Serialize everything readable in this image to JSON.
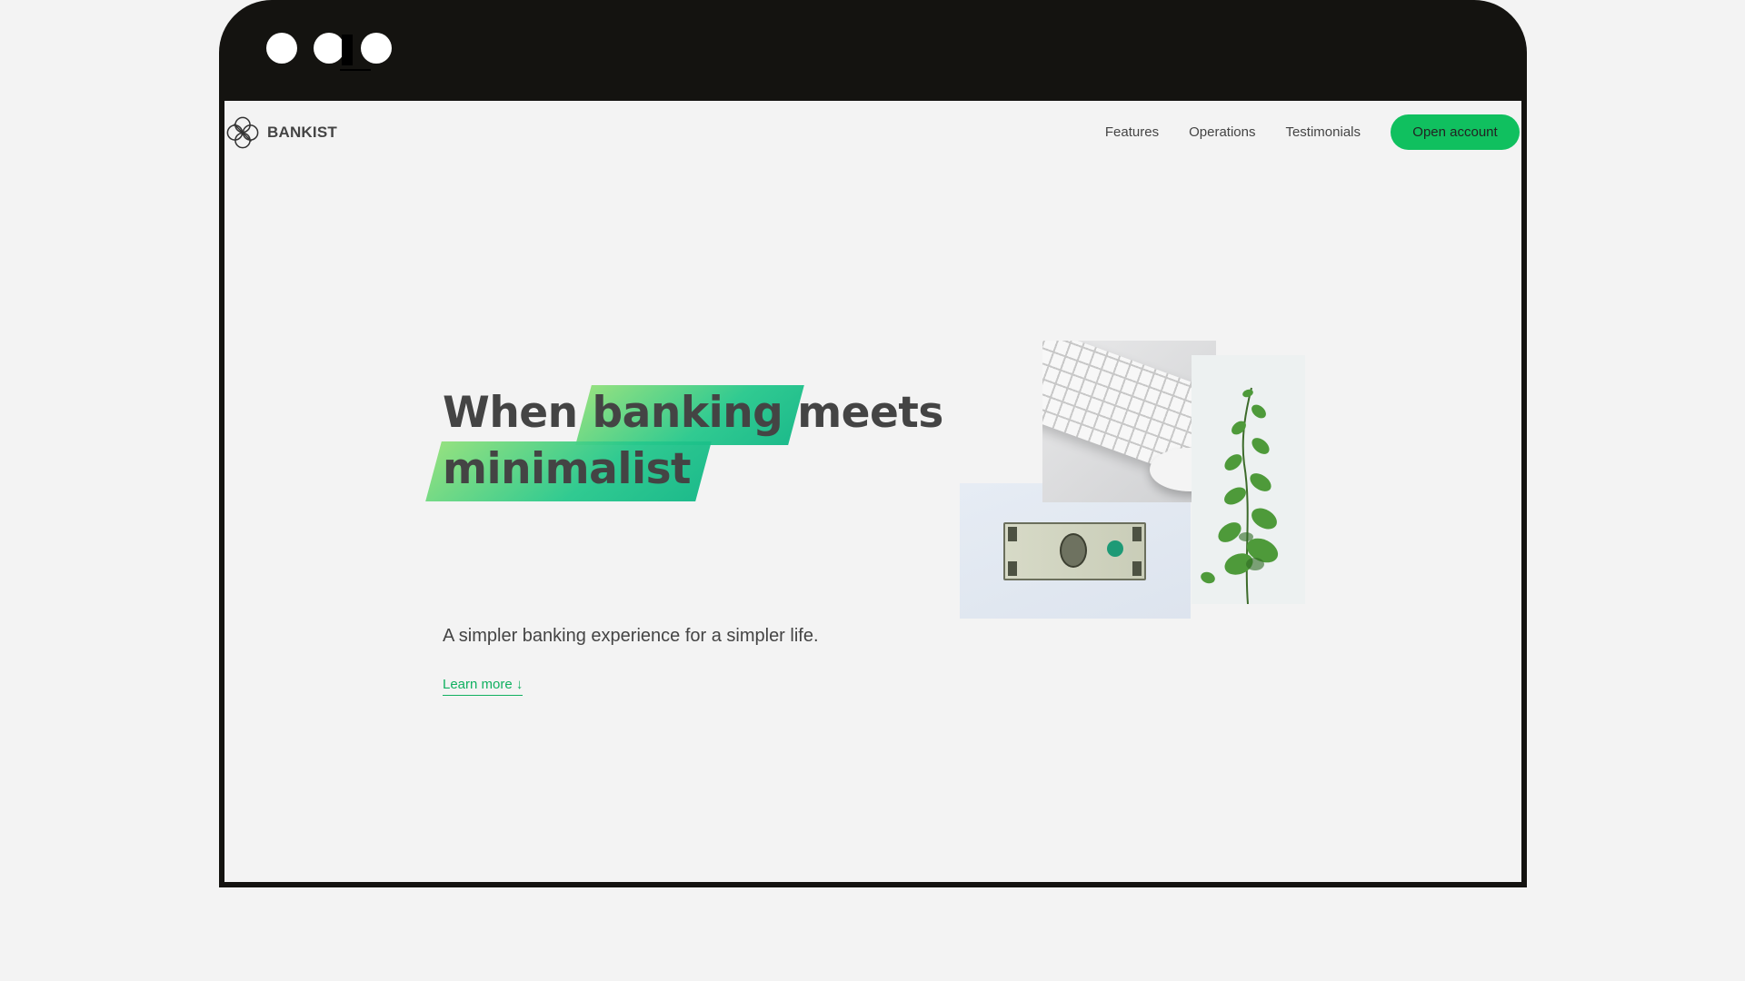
{
  "brand": {
    "name": "BANKIST",
    "icon": "bankist-logo-icon"
  },
  "nav": {
    "links": [
      {
        "label": "Features"
      },
      {
        "label": "Operations"
      },
      {
        "label": "Testimonials"
      }
    ],
    "cta": "Open account"
  },
  "hero": {
    "title_part1": "When",
    "title_highlight1": "banking",
    "title_part2": "meets",
    "title_highlight2": "minimalist",
    "subtitle": "A simpler banking experience for a simpler life.",
    "learn_more": "Learn more ↓",
    "images": [
      "keyboard-and-mouse-image",
      "dollar-bill-image",
      "plant-image"
    ]
  },
  "colors": {
    "accent": "#10c05f",
    "highlight_start": "#8fe07a",
    "highlight_end": "#12b886",
    "frame": "#141310",
    "background": "#f3f3f3",
    "text": "#444444"
  }
}
